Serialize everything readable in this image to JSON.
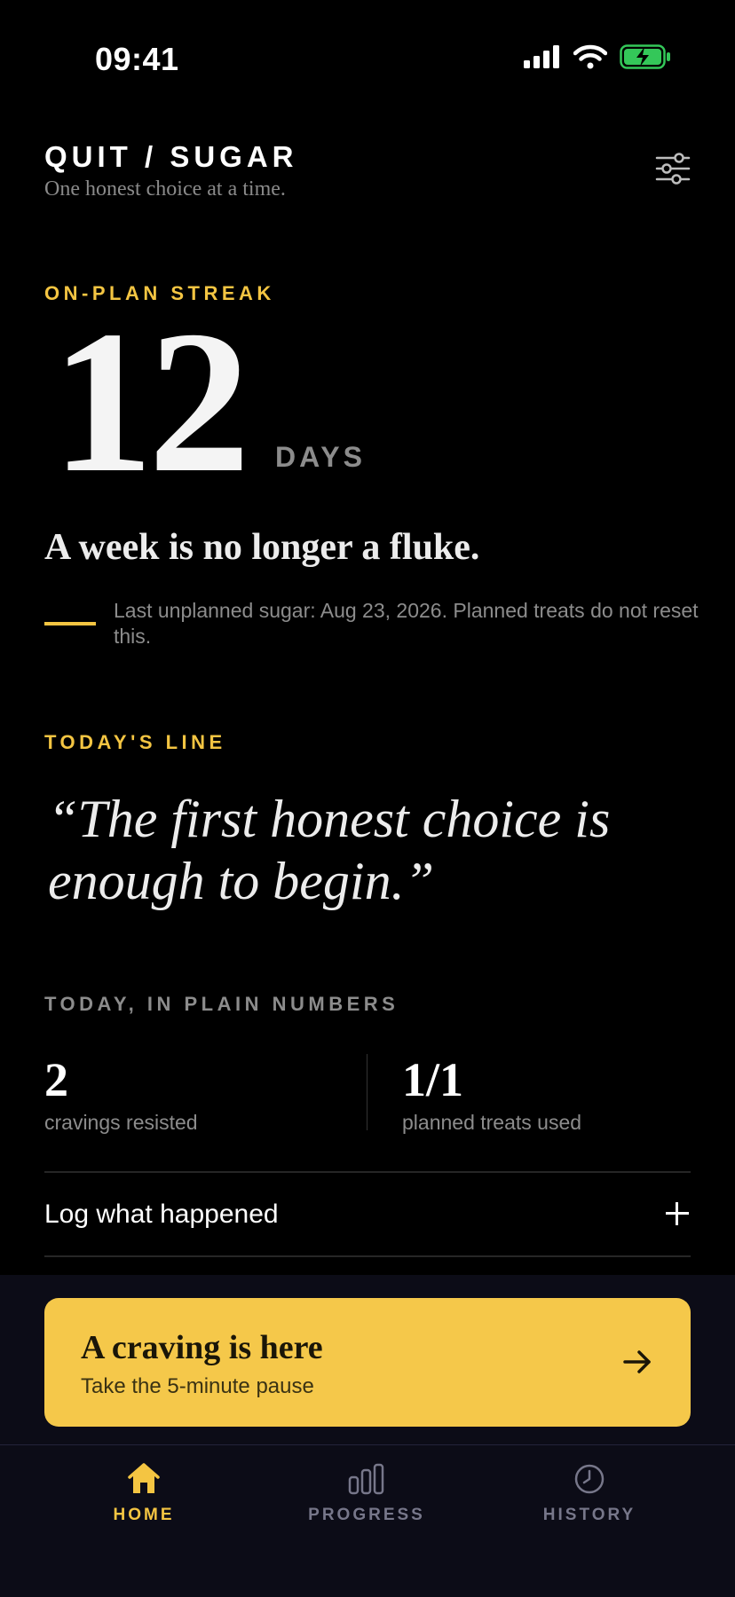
{
  "status_bar": {
    "time": "09:41"
  },
  "header": {
    "title": "QUIT / SUGAR",
    "subtitle": "One honest choice at a time."
  },
  "streak": {
    "label": "ON-PLAN STREAK",
    "value": "12",
    "unit": "DAYS",
    "message": "A week is no longer a fluke.",
    "note": "Last unplanned sugar: Aug 23, 2026. Planned treats do not reset this."
  },
  "today_line": {
    "label": "TODAY'S LINE",
    "quote": "“The first honest choice is enough to begin.”"
  },
  "today_numbers": {
    "label": "TODAY, IN PLAIN NUMBERS",
    "stats": [
      {
        "value": "2",
        "label": "cravings resisted"
      },
      {
        "value": "1/1",
        "label": "planned treats used"
      }
    ]
  },
  "log": {
    "label": "Log what happened"
  },
  "craving_button": {
    "title": "A craving is here",
    "subtitle": "Take the 5-minute pause"
  },
  "tabs": [
    {
      "label": "HOME",
      "icon": "home-icon",
      "active": true
    },
    {
      "label": "PROGRESS",
      "icon": "bar-chart-icon",
      "active": false
    },
    {
      "label": "HISTORY",
      "icon": "clock-icon",
      "active": false
    }
  ],
  "colors": {
    "accent": "#f4c542",
    "background": "#000000",
    "panel": "#0c0c17",
    "muted": "#8c8c8c",
    "battery": "#34c759"
  }
}
